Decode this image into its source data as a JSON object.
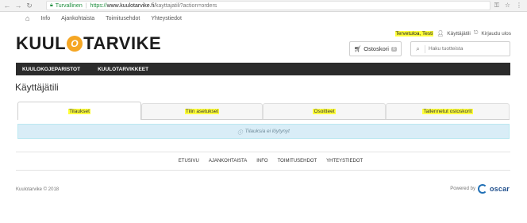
{
  "browser": {
    "secure_label": "Turvallinen",
    "url_scheme": "https://",
    "url_host": "www.kuulotarvike.fi",
    "url_path": "/kayttajatili?action=orders"
  },
  "topnav": {
    "items": [
      "Info",
      "Ajankohtaista",
      "Toimitusehdot",
      "Yhteystiedot"
    ]
  },
  "logo": {
    "left": "KUUL",
    "badge": "O",
    "right": "TARVIKE"
  },
  "account": {
    "welcome": "Tervetuloa, Testi",
    "account_link": "Käyttäjätili",
    "logout_link": "Kirjaudu ulos"
  },
  "basket": {
    "label": "Ostoskori",
    "count": "0"
  },
  "search": {
    "placeholder": "Haku tuotteista"
  },
  "categories": [
    "KUULOKOJEPARISTOT",
    "KUULOTARVIKKEET"
  ],
  "page": {
    "title": "Käyttäjätili"
  },
  "tabs": [
    "Tilaukset",
    "Tilin asetukset",
    "Osoitteet",
    "Tallennetut ostoskorit"
  ],
  "alert": {
    "text": "Tilauksia ei löytynyt"
  },
  "footer": {
    "nav": [
      "ETUSIVU",
      "AJANKOHTAISTA",
      "INFO",
      "TOIMITUSEHDOT",
      "YHTEYSTIEDOT"
    ],
    "copyright": "Kuulotarvike © 2018",
    "powered_by": "Powered by",
    "brand": "oscar"
  }
}
